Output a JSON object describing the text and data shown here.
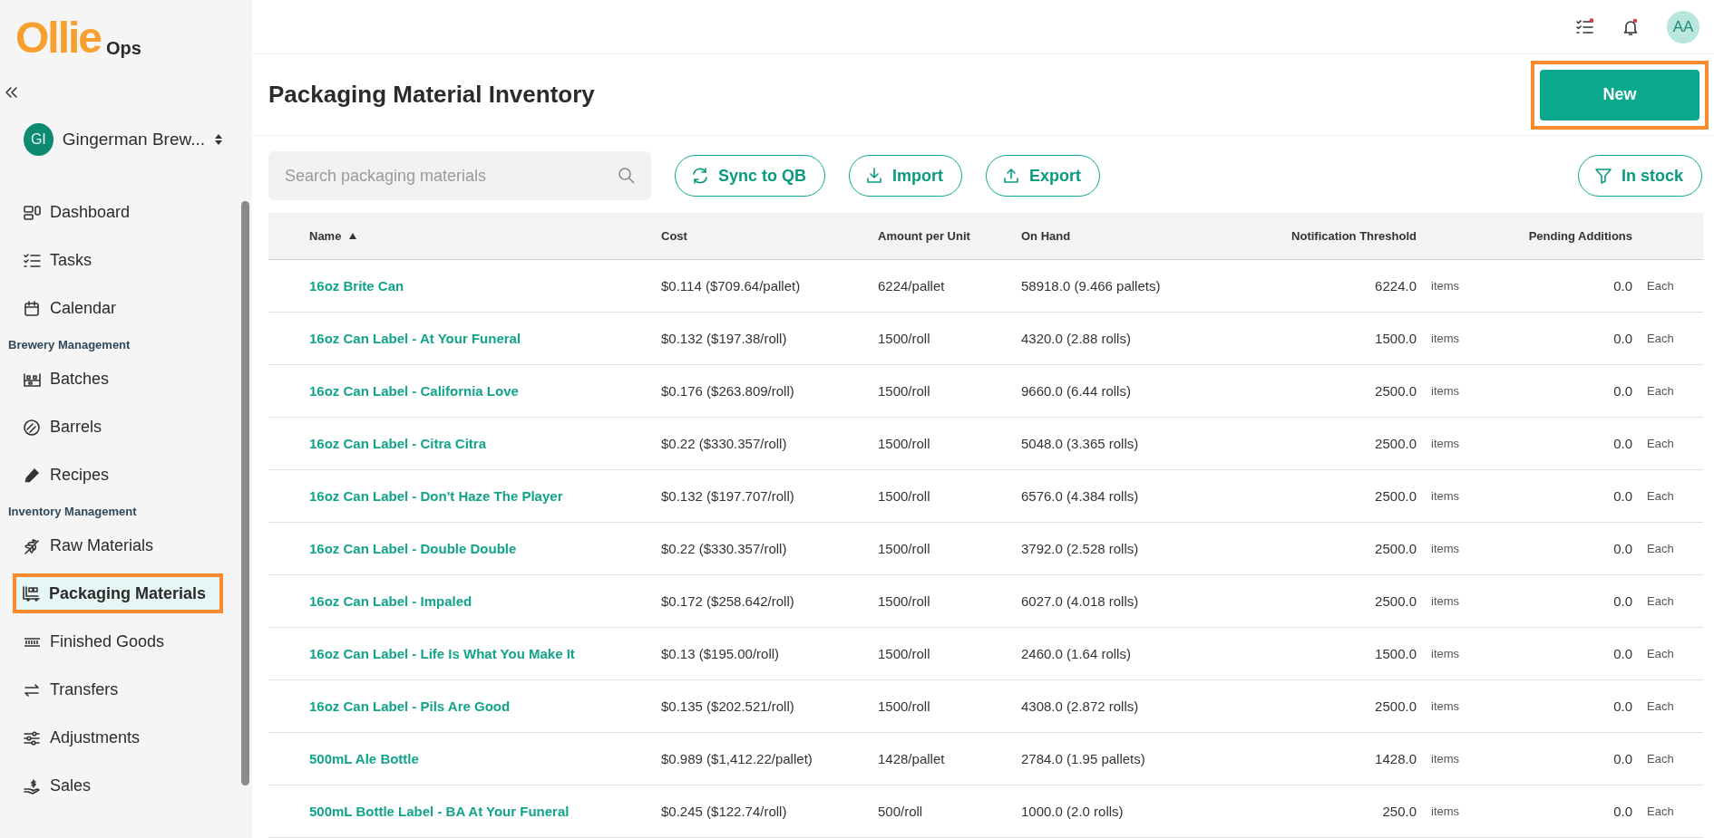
{
  "sidebar": {
    "logo": {
      "brand": "Ollie",
      "suffix": "Ops"
    },
    "org": {
      "initials": "GI",
      "name": "Gingerman Brew..."
    },
    "sections": [
      {
        "items": [
          {
            "label": "Dashboard",
            "selected": false,
            "highlighted": false
          },
          {
            "label": "Tasks",
            "selected": false,
            "highlighted": false
          },
          {
            "label": "Calendar",
            "selected": false,
            "highlighted": false
          }
        ]
      },
      {
        "title": "Brewery Management",
        "items": [
          {
            "label": "Batches",
            "selected": false,
            "highlighted": false
          },
          {
            "label": "Barrels",
            "selected": false,
            "highlighted": false
          },
          {
            "label": "Recipes",
            "selected": false,
            "highlighted": false
          }
        ]
      },
      {
        "title": "Inventory Management",
        "items": [
          {
            "label": "Raw Materials",
            "selected": false,
            "highlighted": false
          },
          {
            "label": "Packaging Materials",
            "selected": true,
            "highlighted": true
          },
          {
            "label": "Finished Goods",
            "selected": false,
            "highlighted": false
          },
          {
            "label": "Transfers",
            "selected": false,
            "highlighted": false
          },
          {
            "label": "Adjustments",
            "selected": false,
            "highlighted": false
          },
          {
            "label": "Sales",
            "selected": false,
            "highlighted": false
          }
        ]
      }
    ]
  },
  "topbar": {
    "avatar": "AA"
  },
  "page": {
    "title": "Packaging Material Inventory",
    "new_button": {
      "label": "New",
      "highlighted": true
    }
  },
  "toolbar": {
    "search": {
      "placeholder": "Search packaging materials"
    },
    "buttons": [
      {
        "label": "Sync to QB"
      },
      {
        "label": "Import"
      },
      {
        "label": "Export"
      }
    ],
    "filter": {
      "label": "In stock"
    }
  },
  "table": {
    "columns": [
      {
        "label": "Name",
        "sorted": true
      },
      {
        "label": "Cost",
        "sorted": false
      },
      {
        "label": "Amount per Unit",
        "sorted": false
      },
      {
        "label": "On Hand",
        "sorted": false
      },
      {
        "label": "Notification Threshold",
        "sorted": false
      },
      {
        "label": "Pending Additions",
        "sorted": false
      }
    ],
    "rows": [
      {
        "name": "16oz Brite Can",
        "cost": "$0.114 ($709.64/pallet)",
        "amount_per_unit": "6224/pallet",
        "on_hand": "58918.0 (9.466 pallets)",
        "threshold": "6224.0",
        "threshold_unit": "items",
        "pending": "0.0",
        "pending_unit": "Each"
      },
      {
        "name": "16oz Can Label - At Your Funeral",
        "cost": "$0.132 ($197.38/roll)",
        "amount_per_unit": "1500/roll",
        "on_hand": "4320.0 (2.88 rolls)",
        "threshold": "1500.0",
        "threshold_unit": "items",
        "pending": "0.0",
        "pending_unit": "Each"
      },
      {
        "name": "16oz Can Label - California Love",
        "cost": "$0.176 ($263.809/roll)",
        "amount_per_unit": "1500/roll",
        "on_hand": "9660.0 (6.44 rolls)",
        "threshold": "2500.0",
        "threshold_unit": "items",
        "pending": "0.0",
        "pending_unit": "Each"
      },
      {
        "name": "16oz Can Label - Citra Citra",
        "cost": "$0.22 ($330.357/roll)",
        "amount_per_unit": "1500/roll",
        "on_hand": "5048.0 (3.365 rolls)",
        "threshold": "2500.0",
        "threshold_unit": "items",
        "pending": "0.0",
        "pending_unit": "Each"
      },
      {
        "name": "16oz Can Label - Don't Haze The Player",
        "cost": "$0.132 ($197.707/roll)",
        "amount_per_unit": "1500/roll",
        "on_hand": "6576.0 (4.384 rolls)",
        "threshold": "2500.0",
        "threshold_unit": "items",
        "pending": "0.0",
        "pending_unit": "Each"
      },
      {
        "name": "16oz Can Label - Double Double",
        "cost": "$0.22 ($330.357/roll)",
        "amount_per_unit": "1500/roll",
        "on_hand": "3792.0 (2.528 rolls)",
        "threshold": "2500.0",
        "threshold_unit": "items",
        "pending": "0.0",
        "pending_unit": "Each"
      },
      {
        "name": "16oz Can Label - Impaled",
        "cost": "$0.172 ($258.642/roll)",
        "amount_per_unit": "1500/roll",
        "on_hand": "6027.0 (4.018 rolls)",
        "threshold": "2500.0",
        "threshold_unit": "items",
        "pending": "0.0",
        "pending_unit": "Each"
      },
      {
        "name": "16oz Can Label - Life Is What You Make It",
        "cost": "$0.13 ($195.00/roll)",
        "amount_per_unit": "1500/roll",
        "on_hand": "2460.0 (1.64 rolls)",
        "threshold": "1500.0",
        "threshold_unit": "items",
        "pending": "0.0",
        "pending_unit": "Each"
      },
      {
        "name": "16oz Can Label - Pils Are Good",
        "cost": "$0.135 ($202.521/roll)",
        "amount_per_unit": "1500/roll",
        "on_hand": "4308.0 (2.872 rolls)",
        "threshold": "2500.0",
        "threshold_unit": "items",
        "pending": "0.0",
        "pending_unit": "Each"
      },
      {
        "name": "500mL Ale Bottle",
        "cost": "$0.989 ($1,412.22/pallet)",
        "amount_per_unit": "1428/pallet",
        "on_hand": "2784.0 (1.95 pallets)",
        "threshold": "1428.0",
        "threshold_unit": "items",
        "pending": "0.0",
        "pending_unit": "Each"
      },
      {
        "name": "500mL Bottle Label - BA At Your Funeral",
        "cost": "$0.245 ($122.74/roll)",
        "amount_per_unit": "500/roll",
        "on_hand": "1000.0 (2.0 rolls)",
        "threshold": "250.0",
        "threshold_unit": "items",
        "pending": "0.0",
        "pending_unit": "Each"
      }
    ]
  }
}
